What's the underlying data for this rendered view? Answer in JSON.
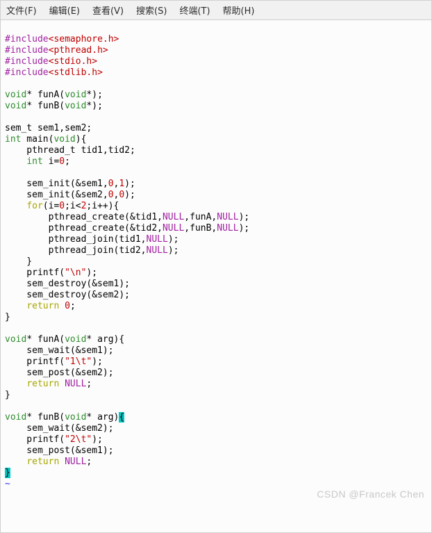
{
  "menubar": {
    "file": "文件(F)",
    "edit": "编辑(E)",
    "view": "查看(V)",
    "search": "搜索(S)",
    "terminal": "终端(T)",
    "help": "帮助(H)"
  },
  "code": {
    "inc1_kw": "#include",
    "inc1_hdr": "<semaphore.h>",
    "inc2_kw": "#include",
    "inc2_hdr": "<pthread.h>",
    "inc3_kw": "#include",
    "inc3_hdr": "<stdio.h>",
    "inc4_kw": "#include",
    "inc4_hdr": "<stdlib.h>",
    "blank": "",
    "funA_proto_ret": "void",
    "funA_proto_star": "* funA(",
    "funA_proto_arg": "void",
    "funA_proto_end": "*);",
    "funB_proto_ret": "void",
    "funB_proto_star": "* funB(",
    "funB_proto_arg": "void",
    "funB_proto_end": "*);",
    "semdecl": "sem_t sem1,sem2;",
    "int": "int",
    "main_sig": " main(",
    "void": "void",
    "main_sig_end": "){",
    "decl1_indent": "    pthread_t tid1,tid2;",
    "decl2_indent_pre": "    ",
    "decl2_int": "int",
    "decl2_post": " i=",
    "decl2_zero": "0",
    "decl2_semi": ";",
    "sinit1_pre": "    sem_init(&sem1,",
    "sinit1_a": "0",
    "sinit1_c": ",",
    "sinit1_b": "1",
    "sinit1_end": ");",
    "sinit2_pre": "    sem_init(&sem2,",
    "sinit2_a": "0",
    "sinit2_c": ",",
    "sinit2_b": "0",
    "sinit2_end": ");",
    "for_kw": "for",
    "for_open": "(i=",
    "for_0a": "0",
    "for_semi1": ";i<",
    "for_2": "2",
    "for_rest": ";i++){",
    "pc1_pre": "        pthread_create(&tid1,",
    "pc1_null1": "NULL",
    "pc1_mid": ",funA,",
    "pc1_null2": "NULL",
    "pc1_end": ");",
    "pc2_pre": "        pthread_create(&tid2,",
    "pc2_null1": "NULL",
    "pc2_mid": ",funB,",
    "pc2_null2": "NULL",
    "pc2_end": ");",
    "pj1_pre": "        pthread_join(tid1,",
    "pj1_null": "NULL",
    "pj1_end": ");",
    "pj2_pre": "        pthread_join(tid2,",
    "pj2_null": "NULL",
    "pj2_end": ");",
    "brace_for": "    }",
    "printfn_pre": "    printf(",
    "printfn_str": "\"\\n\"",
    "printfn_end": ");",
    "sd1": "    sem_destroy(&sem1);",
    "sd2": "    sem_destroy(&sem2);",
    "ret0_pre": "    ",
    "ret0_kw": "return",
    "ret0_sp": " ",
    "ret0_val": "0",
    "ret0_end": ";",
    "brace_main": "}",
    "funA_ret": "void",
    "funA_star": "* funA(",
    "funA_arg": "void",
    "funA_argend": "* arg){",
    "funA_wait": "    sem_wait(&sem1);",
    "funA_printf_pre": "    printf(",
    "funA_printf_str": "\"1\\t\"",
    "funA_printf_end": ");",
    "funA_post": "    sem_post(&sem2);",
    "funA_retnull_pre": "    ",
    "funA_retnull_kw": "return",
    "funA_retnull_sp": " ",
    "funA_retnull_val": "NULL",
    "funA_retnull_end": ";",
    "funA_close": "}",
    "funB_ret": "void",
    "funB_star": "* funB(",
    "funB_arg": "void",
    "funB_argend": "* arg)",
    "funB_brace": "{",
    "funB_wait": "    sem_wait(&sem2);",
    "funB_printf_pre": "    printf(",
    "funB_printf_str": "\"2\\t\"",
    "funB_printf_end": ");",
    "funB_post": "    sem_post(&sem1);",
    "funB_retnull_pre": "    ",
    "funB_retnull_kw": "return",
    "funB_retnull_sp": " ",
    "funB_retnull_val": "NULL",
    "funB_retnull_end": ";",
    "funB_close": "}",
    "tilde": "~"
  },
  "watermark": "CSDN @Francek Chen"
}
